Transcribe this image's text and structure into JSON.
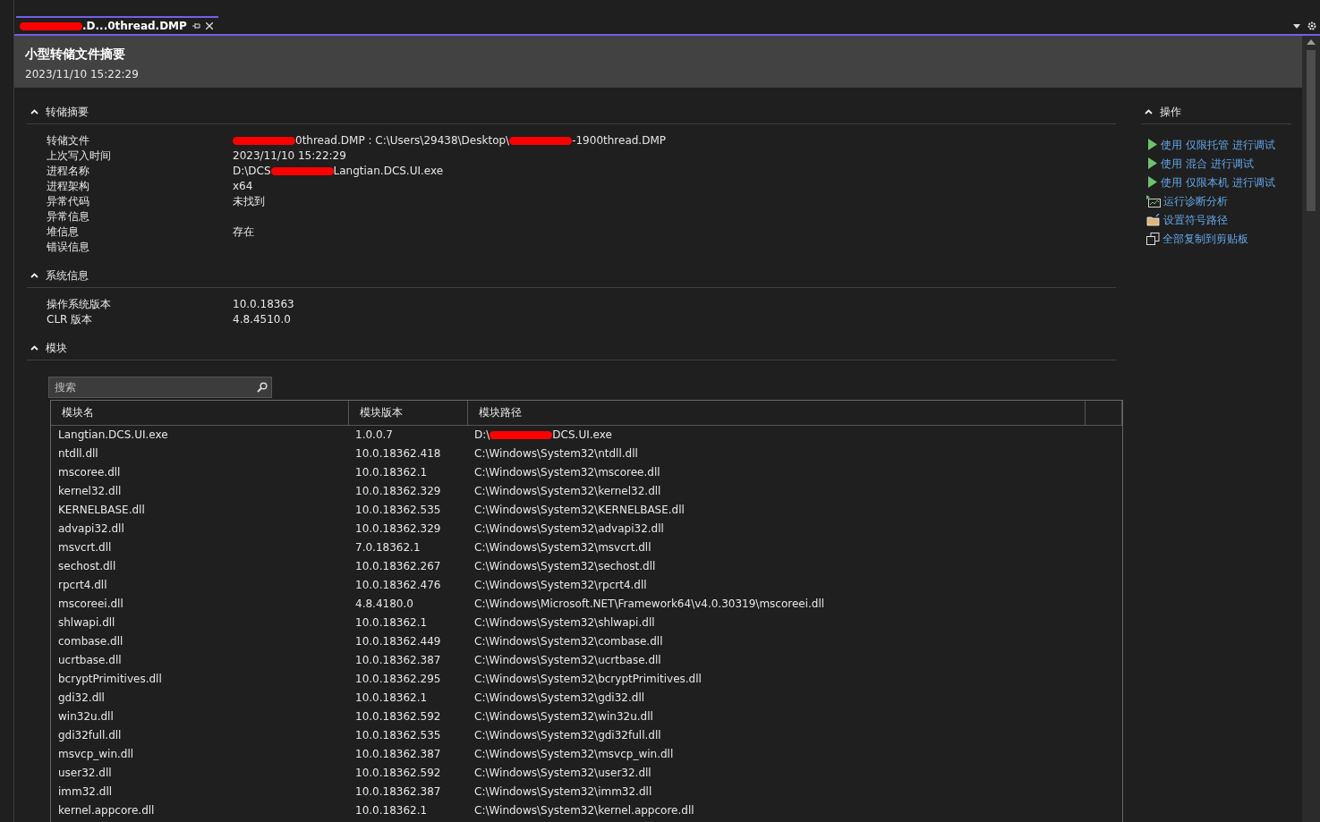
{
  "tab": {
    "title": [
      {
        "kind": "redacted"
      },
      {
        "kind": "text",
        "text": ".D...0thread.DMP"
      }
    ],
    "selected": true
  },
  "header": {
    "title": "小型转储文件摘要",
    "time": "2023/11/10 15:22:29"
  },
  "sections": [
    {
      "title": "转储摘要",
      "expanded": true,
      "rows": [
        {
          "label": "转储文件",
          "value": [
            {
              "kind": "redacted"
            },
            {
              "kind": "text",
              "text": "0thread.DMP : C:\\Users\\29438\\Desktop\\"
            },
            {
              "kind": "redacted"
            },
            {
              "kind": "text",
              "text": "-1900thread.DMP"
            }
          ]
        },
        {
          "label": "上次写入时间",
          "value": [
            {
              "kind": "text",
              "text": "2023/11/10 15:22:29"
            }
          ]
        },
        {
          "label": "进程名称",
          "value": [
            {
              "kind": "text",
              "text": "D:\\DCS"
            },
            {
              "kind": "redacted"
            },
            {
              "kind": "text",
              "text": "Langtian.DCS.UI.exe"
            }
          ]
        },
        {
          "label": "进程架构",
          "value": [
            {
              "kind": "text",
              "text": "x64"
            }
          ]
        },
        {
          "label": "异常代码",
          "value": [
            {
              "kind": "text",
              "text": "未找到"
            }
          ]
        },
        {
          "label": "异常信息",
          "value": []
        },
        {
          "label": "堆信息",
          "value": [
            {
              "kind": "text",
              "text": "存在"
            }
          ]
        },
        {
          "label": "错误信息",
          "value": []
        }
      ]
    },
    {
      "title": "系统信息",
      "expanded": true,
      "rows": [
        {
          "label": "操作系统版本",
          "value": [
            {
              "kind": "text",
              "text": "10.0.18363"
            }
          ]
        },
        {
          "label": "CLR 版本",
          "value": [
            {
              "kind": "text",
              "text": "4.8.4510.0"
            }
          ]
        }
      ]
    }
  ],
  "modules": {
    "title": "模块",
    "expanded": true,
    "search": {
      "placeholder": "搜索"
    },
    "columns": [
      "模块名",
      "模块版本",
      "模块路径"
    ],
    "rows": [
      {
        "name": "Langtian.DCS.UI.exe",
        "version": "1.0.0.7",
        "path": [
          {
            "kind": "text",
            "text": "D:\\"
          },
          {
            "kind": "redacted"
          },
          {
            "kind": "text",
            "text": "DCS.UI.exe"
          }
        ]
      },
      {
        "name": "ntdll.dll",
        "version": "10.0.18362.418",
        "path": [
          {
            "kind": "text",
            "text": "C:\\Windows\\System32\\ntdll.dll"
          }
        ]
      },
      {
        "name": "mscoree.dll",
        "version": "10.0.18362.1",
        "path": [
          {
            "kind": "text",
            "text": "C:\\Windows\\System32\\mscoree.dll"
          }
        ]
      },
      {
        "name": "kernel32.dll",
        "version": "10.0.18362.329",
        "path": [
          {
            "kind": "text",
            "text": "C:\\Windows\\System32\\kernel32.dll"
          }
        ]
      },
      {
        "name": "KERNELBASE.dll",
        "version": "10.0.18362.535",
        "path": [
          {
            "kind": "text",
            "text": "C:\\Windows\\System32\\KERNELBASE.dll"
          }
        ]
      },
      {
        "name": "advapi32.dll",
        "version": "10.0.18362.329",
        "path": [
          {
            "kind": "text",
            "text": "C:\\Windows\\System32\\advapi32.dll"
          }
        ]
      },
      {
        "name": "msvcrt.dll",
        "version": "7.0.18362.1",
        "path": [
          {
            "kind": "text",
            "text": "C:\\Windows\\System32\\msvcrt.dll"
          }
        ]
      },
      {
        "name": "sechost.dll",
        "version": "10.0.18362.267",
        "path": [
          {
            "kind": "text",
            "text": "C:\\Windows\\System32\\sechost.dll"
          }
        ]
      },
      {
        "name": "rpcrt4.dll",
        "version": "10.0.18362.476",
        "path": [
          {
            "kind": "text",
            "text": "C:\\Windows\\System32\\rpcrt4.dll"
          }
        ]
      },
      {
        "name": "mscoreei.dll",
        "version": "4.8.4180.0",
        "path": [
          {
            "kind": "text",
            "text": "C:\\Windows\\Microsoft.NET\\Framework64\\v4.0.30319\\mscoreei.dll"
          }
        ]
      },
      {
        "name": "shlwapi.dll",
        "version": "10.0.18362.1",
        "path": [
          {
            "kind": "text",
            "text": "C:\\Windows\\System32\\shlwapi.dll"
          }
        ]
      },
      {
        "name": "combase.dll",
        "version": "10.0.18362.449",
        "path": [
          {
            "kind": "text",
            "text": "C:\\Windows\\System32\\combase.dll"
          }
        ]
      },
      {
        "name": "ucrtbase.dll",
        "version": "10.0.18362.387",
        "path": [
          {
            "kind": "text",
            "text": "C:\\Windows\\System32\\ucrtbase.dll"
          }
        ]
      },
      {
        "name": "bcryptPrimitives.dll",
        "version": "10.0.18362.295",
        "path": [
          {
            "kind": "text",
            "text": "C:\\Windows\\System32\\bcryptPrimitives.dll"
          }
        ]
      },
      {
        "name": "gdi32.dll",
        "version": "10.0.18362.1",
        "path": [
          {
            "kind": "text",
            "text": "C:\\Windows\\System32\\gdi32.dll"
          }
        ]
      },
      {
        "name": "win32u.dll",
        "version": "10.0.18362.592",
        "path": [
          {
            "kind": "text",
            "text": "C:\\Windows\\System32\\win32u.dll"
          }
        ]
      },
      {
        "name": "gdi32full.dll",
        "version": "10.0.18362.535",
        "path": [
          {
            "kind": "text",
            "text": "C:\\Windows\\System32\\gdi32full.dll"
          }
        ]
      },
      {
        "name": "msvcp_win.dll",
        "version": "10.0.18362.387",
        "path": [
          {
            "kind": "text",
            "text": "C:\\Windows\\System32\\msvcp_win.dll"
          }
        ]
      },
      {
        "name": "user32.dll",
        "version": "10.0.18362.592",
        "path": [
          {
            "kind": "text",
            "text": "C:\\Windows\\System32\\user32.dll"
          }
        ]
      },
      {
        "name": "imm32.dll",
        "version": "10.0.18362.387",
        "path": [
          {
            "kind": "text",
            "text": "C:\\Windows\\System32\\imm32.dll"
          }
        ]
      },
      {
        "name": "kernel.appcore.dll",
        "version": "10.0.18362.1",
        "path": [
          {
            "kind": "text",
            "text": "C:\\Windows\\System32\\kernel.appcore.dll"
          }
        ]
      }
    ]
  },
  "actions": {
    "title": "操作",
    "expanded": true,
    "items": [
      {
        "kind": "play",
        "label": "使用 仅限托管 进行调试"
      },
      {
        "kind": "play",
        "label": "使用 混合 进行调试"
      },
      {
        "kind": "play",
        "label": "使用 仅限本机 进行调试"
      },
      {
        "kind": "diagnostics",
        "label": "运行诊断分析"
      },
      {
        "kind": "folder",
        "label": "设置符号路径"
      },
      {
        "kind": "copy",
        "label": "全部复制到剪贴板"
      }
    ]
  }
}
